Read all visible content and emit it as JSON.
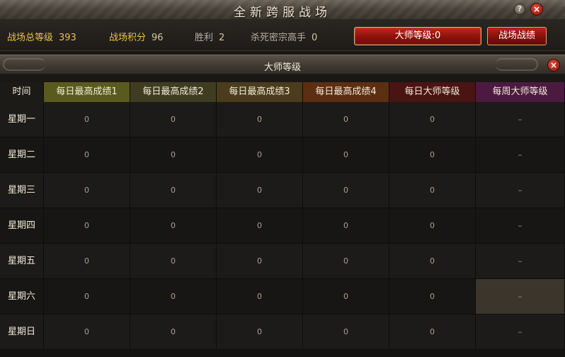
{
  "window": {
    "title": "全新跨服战场"
  },
  "stats": {
    "total_level_label": "战场总等级",
    "total_level_value": "393",
    "points_label": "战场积分",
    "points_value": "96",
    "wins_label": "胜利",
    "wins_value": "2",
    "kills_label": "杀死密宗高手",
    "kills_value": "0",
    "master_level_button": "大师等级:0",
    "battle_record_button": "战场战绩"
  },
  "panel": {
    "title": "大师等级"
  },
  "table": {
    "columns": [
      {
        "label": "时间",
        "color": "#1c1a17"
      },
      {
        "label": "每日最高成绩1",
        "color": "#5a5a1e"
      },
      {
        "label": "每日最高成绩2",
        "color": "#3e3d22"
      },
      {
        "label": "每日最高成绩3",
        "color": "#4a3c1c"
      },
      {
        "label": "每日最高成绩4",
        "color": "#5c2e12"
      },
      {
        "label": "每日大师等级",
        "color": "#4a1412"
      },
      {
        "label": "每周大师等级",
        "color": "#4c1a40"
      }
    ],
    "rows": [
      {
        "day": "星期一",
        "values": [
          "0",
          "0",
          "0",
          "0",
          "0",
          "–"
        ]
      },
      {
        "day": "星期二",
        "values": [
          "0",
          "0",
          "0",
          "0",
          "0",
          "–"
        ]
      },
      {
        "day": "星期三",
        "values": [
          "0",
          "0",
          "0",
          "0",
          "0",
          "–"
        ]
      },
      {
        "day": "星期四",
        "values": [
          "0",
          "0",
          "0",
          "0",
          "0",
          "–"
        ]
      },
      {
        "day": "星期五",
        "values": [
          "0",
          "0",
          "0",
          "0",
          "0",
          "–"
        ]
      },
      {
        "day": "星期六",
        "values": [
          "0",
          "0",
          "0",
          "0",
          "0",
          "–"
        ]
      },
      {
        "day": "星期日",
        "values": [
          "0",
          "0",
          "0",
          "0",
          "0",
          "–"
        ]
      }
    ],
    "highlight_cell": {
      "row": 5,
      "col": 6,
      "color": "#3b352b"
    }
  },
  "icons": {
    "help": "help-icon",
    "close": "close-icon"
  },
  "icon_glyphs": {
    "help": "?",
    "close": "×"
  }
}
